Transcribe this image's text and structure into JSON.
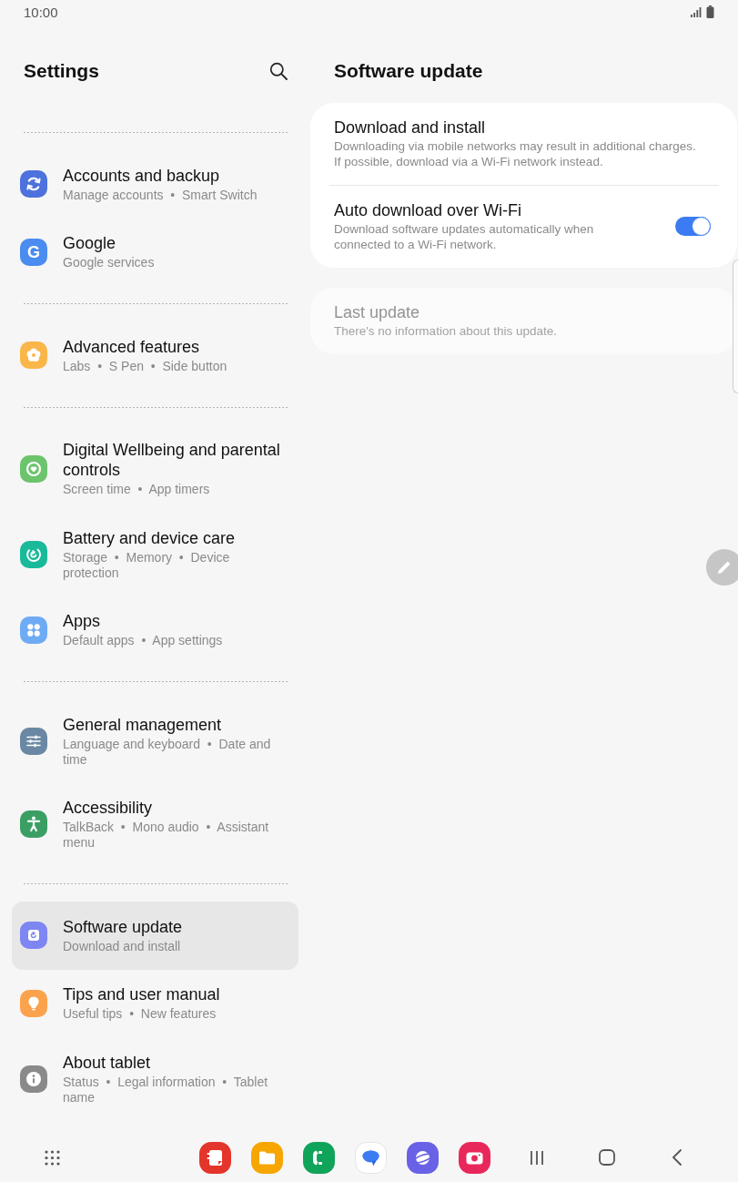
{
  "status_bar": {
    "time": "10:00"
  },
  "settings": {
    "title": "Settings",
    "groups": [
      {
        "items": [
          {
            "title": "Accounts and backup",
            "subtitle": "Manage accounts  •  Smart Switch",
            "color": "#4d72dd",
            "selected": false
          },
          {
            "title": "Google",
            "subtitle": "Google services",
            "color": "#4a8cf0",
            "icon_text": "G",
            "selected": false
          }
        ]
      },
      {
        "items": [
          {
            "title": "Advanced features",
            "subtitle": "Labs  •  S Pen  •  Side button",
            "color": "#fbb64a",
            "selected": false
          }
        ]
      },
      {
        "items": [
          {
            "title": "Digital Wellbeing and parental controls",
            "subtitle": "Screen time  •  App timers",
            "color": "#6cc46c",
            "selected": false
          },
          {
            "title": "Battery and device care",
            "subtitle": "Storage  •  Memory  •  Device protection",
            "color": "#19b999",
            "selected": false
          },
          {
            "title": "Apps",
            "subtitle": "Default apps  •  App settings",
            "color": "#6eabf5",
            "selected": false
          }
        ]
      },
      {
        "items": [
          {
            "title": "General management",
            "subtitle": "Language and keyboard  •  Date and time",
            "color": "#6a88a3",
            "selected": false
          },
          {
            "title": "Accessibility",
            "subtitle": "TalkBack  •  Mono audio  •  Assistant menu",
            "color": "#3b9f64",
            "selected": false
          }
        ]
      },
      {
        "items": [
          {
            "title": "Software update",
            "subtitle": "Download and install",
            "color": "#7d86f3",
            "selected": true
          },
          {
            "title": "Tips and user manual",
            "subtitle": "Useful tips  •  New features",
            "color": "#fba24c",
            "selected": false
          },
          {
            "title": "About tablet",
            "subtitle": "Status  •  Legal information  •  Tablet name",
            "color": "#8a8a8a",
            "selected": false
          }
        ]
      }
    ]
  },
  "software_update": {
    "title": "Software update",
    "cards": [
      {
        "disabled": false,
        "rows": [
          {
            "kind": "action",
            "title": "Download and install",
            "description": "Downloading via mobile networks may result in additional charges. If possible, download via a Wi-Fi network instead."
          },
          {
            "kind": "toggle",
            "title": "Auto download over Wi-Fi",
            "description": "Download software updates automatically when connected to a Wi-Fi network.",
            "on": true
          }
        ]
      },
      {
        "disabled": true,
        "rows": [
          {
            "kind": "action",
            "title": "Last update",
            "description": "There's no information about this update."
          }
        ]
      }
    ]
  }
}
